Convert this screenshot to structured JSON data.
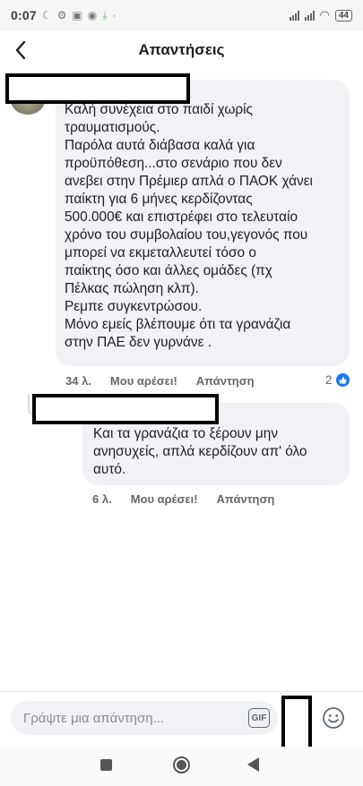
{
  "status_bar": {
    "time": "0:07",
    "battery": "44"
  },
  "header": {
    "title": "Απαντήσεις"
  },
  "comment": {
    "lines": [
      "Καλή συνέχεια στο παιδί χωρίς",
      "τραυματισμούς.",
      "Παρόλα αυτά διάβασα καλά για",
      "προϋπόθεση...στο σενάριο που δεν",
      "ανεβει στην Πρέμιερ απλά ο ΠΑΟΚ χάνει",
      "παίκτη για 6 μήνες κερδίζοντας",
      "500.000€ και επιστρέφει στο τελευταίο",
      "χρόνο του συμβολαίου του,γεγονός που",
      "μπορεί να εκμεταλλευτεί τόσο ο",
      "παίκτης όσο και άλλες ομάδες (πχ",
      "Πέλκας πώληση κλπ).",
      "Ρεμπε συγκεντρώσου.",
      "Μόνο εμείς βλέπουμε ότι τα γρανάζια",
      "στην ΠΑΕ δεν γυρνάνε ."
    ],
    "time": "34 λ.",
    "like_label": "Μου αρέσει!",
    "reply_label": "Απάντηση",
    "reaction_count": "2"
  },
  "reply": {
    "lines": [
      "Και τα γρανάζια το ξέρουν μην",
      "ανησυχείς, απλά κερδίζουν απ' όλο",
      "αυτό."
    ],
    "time": "6 λ.",
    "like_label": "Μου αρέσει!",
    "reply_label": "Απάντηση"
  },
  "composer": {
    "placeholder": "Γράψτε μια απάντηση...",
    "gif_label": "GIF"
  }
}
